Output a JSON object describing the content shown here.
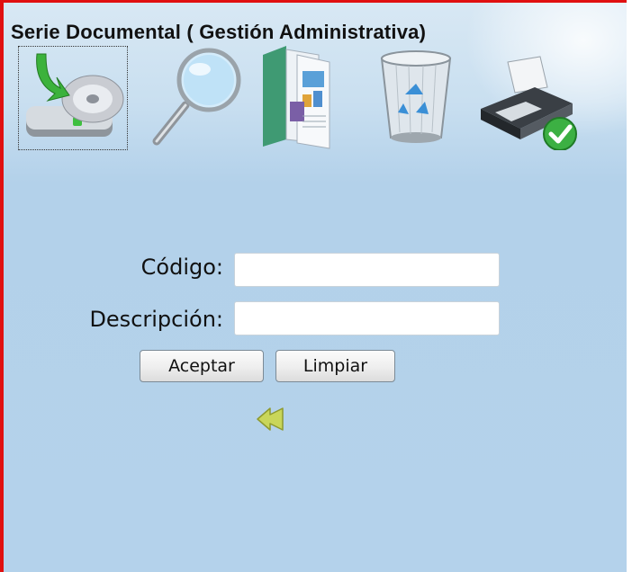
{
  "window": {
    "title": "Serie Documental ( Gestión Administrativa)"
  },
  "toolbar": {
    "items": [
      {
        "icon": "save-disk-icon"
      },
      {
        "icon": "search-magnifier-icon"
      },
      {
        "icon": "report-document-icon"
      },
      {
        "icon": "recycle-bin-icon"
      },
      {
        "icon": "printer-check-icon"
      }
    ]
  },
  "form": {
    "codigo_label": "Código:",
    "codigo_value": "",
    "descripcion_label": "Descripción:",
    "descripcion_value": ""
  },
  "buttons": {
    "accept_label": "Aceptar",
    "clear_label": "Limpiar"
  },
  "nav": {
    "back_icon": "double-left-arrow-icon"
  },
  "colors": {
    "border": "#e01010",
    "background": "#b4d2eb",
    "back_arrow": "#c9d65a"
  }
}
